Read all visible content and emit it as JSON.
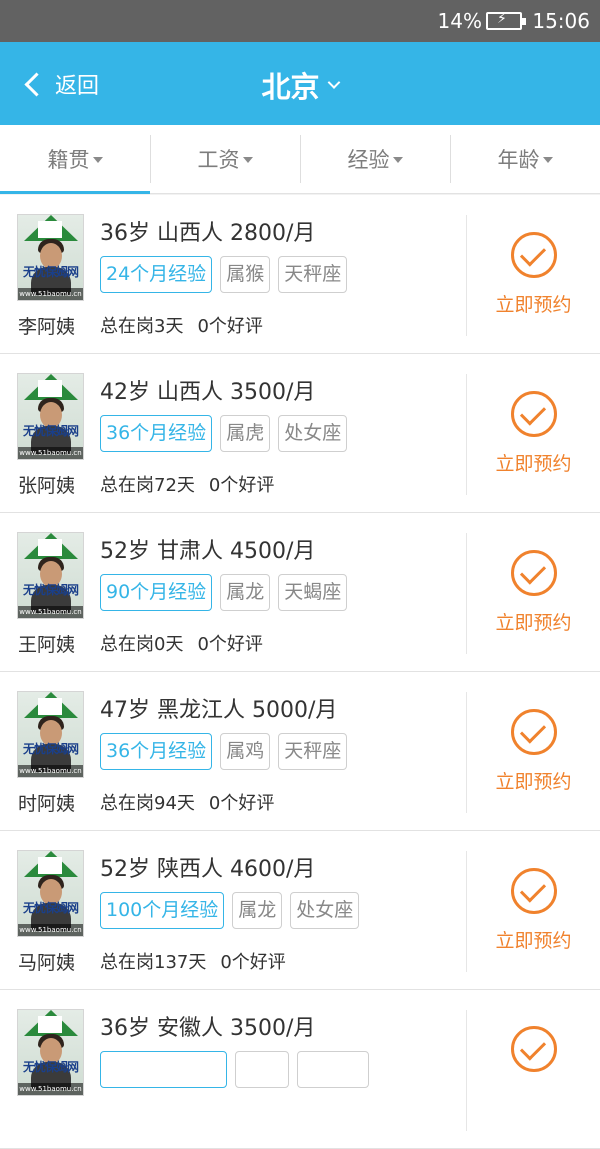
{
  "status_bar": {
    "battery": "14%",
    "time": "15:06"
  },
  "nav": {
    "back_label": "返回",
    "city": "北京"
  },
  "filters": [
    {
      "label": "籍贯"
    },
    {
      "label": "工资"
    },
    {
      "label": "经验"
    },
    {
      "label": "年龄"
    }
  ],
  "photo_text": {
    "brand": "无忧保姆网",
    "site": "www.51baomu.cn"
  },
  "book_label": "立即预约",
  "nannies": [
    {
      "name": "李阿姨",
      "headline": "36岁 山西人 2800/月",
      "experience": "24个月经验",
      "zodiac": "属猴",
      "star_sign": "天秤座",
      "days": "总在岗3天",
      "reviews": "0个好评"
    },
    {
      "name": "张阿姨",
      "headline": "42岁 山西人 3500/月",
      "experience": "36个月经验",
      "zodiac": "属虎",
      "star_sign": "处女座",
      "days": "总在岗72天",
      "reviews": "0个好评"
    },
    {
      "name": "王阿姨",
      "headline": "52岁 甘肃人 4500/月",
      "experience": "90个月经验",
      "zodiac": "属龙",
      "star_sign": "天蝎座",
      "days": "总在岗0天",
      "reviews": "0个好评"
    },
    {
      "name": "时阿姨",
      "headline": "47岁 黑龙江人 5000/月",
      "experience": "36个月经验",
      "zodiac": "属鸡",
      "star_sign": "天秤座",
      "days": "总在岗94天",
      "reviews": "0个好评"
    },
    {
      "name": "马阿姨",
      "headline": "52岁 陕西人 4600/月",
      "experience": "100个月经验",
      "zodiac": "属龙",
      "star_sign": "处女座",
      "days": "总在岗137天",
      "reviews": "0个好评"
    },
    {
      "name": "",
      "headline": "36岁 安徽人 3500/月",
      "experience": "",
      "zodiac": "",
      "star_sign": "",
      "days": "",
      "reviews": ""
    }
  ]
}
